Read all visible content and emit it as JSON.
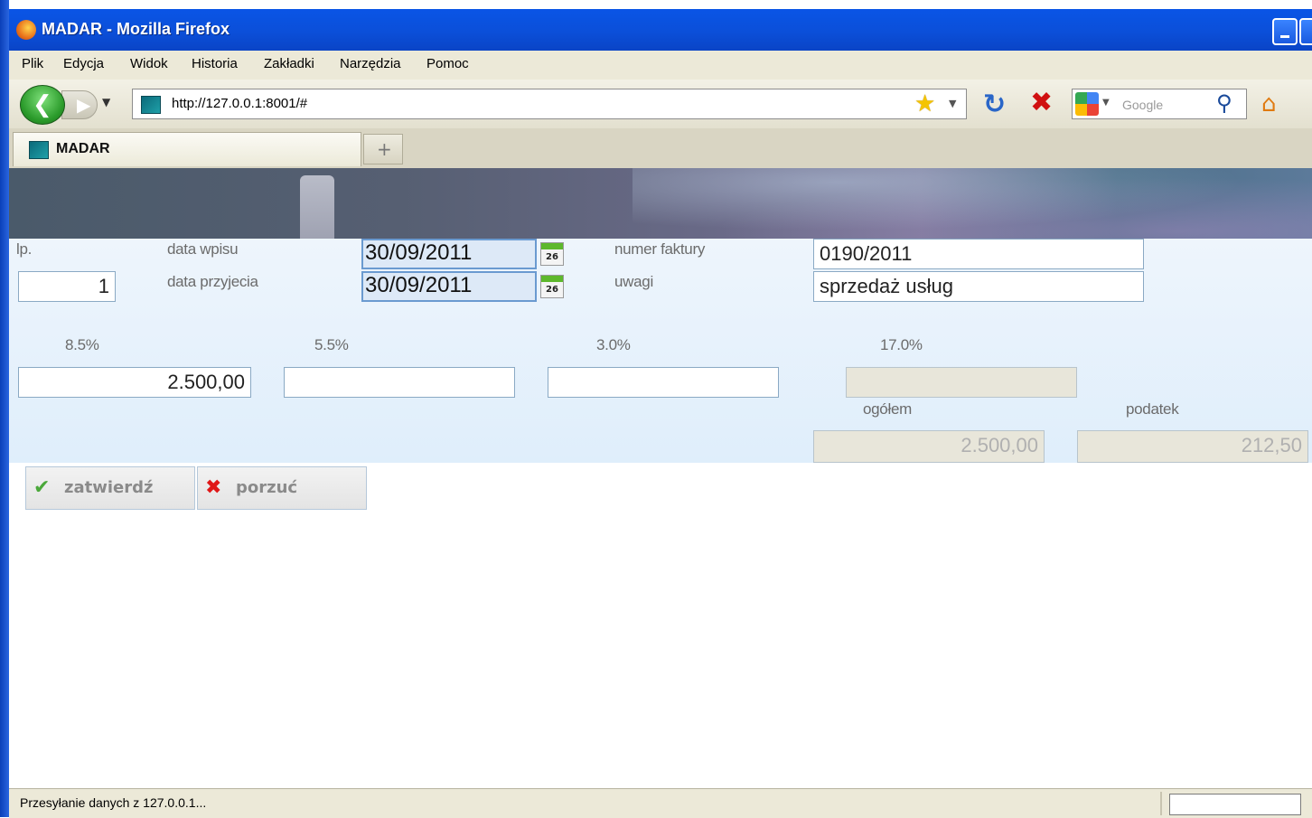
{
  "window": {
    "title": "MADAR - Mozilla Firefox"
  },
  "menu": [
    "Plik",
    "Edycja",
    "Widok",
    "Historia",
    "Zakładki",
    "Narzędzia",
    "Pomoc"
  ],
  "nav": {
    "url": "http://127.0.0.1:8001/#",
    "search_placeholder": "Google"
  },
  "tabs": [
    {
      "label": "MADAR"
    }
  ],
  "form": {
    "lp_label": "lp.",
    "lp_value": "1",
    "data_wpisu_label": "data wpisu",
    "data_wpisu_value": "30/09/2011",
    "data_przyjecia_label": "data przyjecia",
    "data_przyjecia_value": "30/09/2011",
    "calendar_day": "26",
    "numer_faktury_label": "numer faktury",
    "numer_faktury_value": "0190/2011",
    "uwagi_label": "uwagi",
    "uwagi_value": "sprzedaż usług",
    "rates": [
      {
        "label": "8.5%",
        "value": "2.500,00"
      },
      {
        "label": "5.5%",
        "value": ""
      },
      {
        "label": "3.0%",
        "value": ""
      },
      {
        "label": "17.0%",
        "value": ""
      }
    ],
    "ogolem_label": "ogółem",
    "ogolem_value": "2.500,00",
    "podatek_label": "podatek",
    "podatek_value": "212,50"
  },
  "buttons": {
    "confirm": "zatwierdź",
    "discard": "porzuć"
  },
  "status": {
    "text": "Przesyłanie danych z 127.0.0.1..."
  },
  "colors": {
    "titlebar": "#0a55e6",
    "form_bg": "#e6f1fb",
    "date_field": "#dde9f7"
  }
}
